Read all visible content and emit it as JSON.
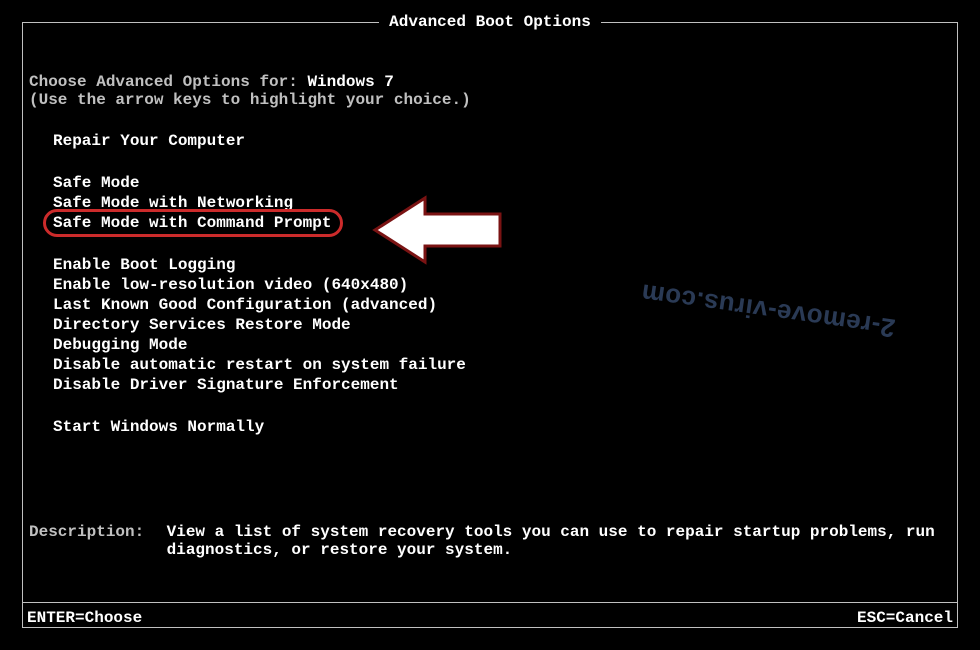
{
  "title": "Advanced Boot Options",
  "choose": {
    "prefix": "Choose Advanced Options for: ",
    "os": "Windows 7"
  },
  "hint": "(Use the arrow keys to highlight your choice.)",
  "menu": {
    "repair": "Repair Your Computer",
    "safe_mode": "Safe Mode",
    "safe_mode_net": "Safe Mode with Networking",
    "safe_mode_cmd": "Safe Mode with Command Prompt",
    "boot_logging": "Enable Boot Logging",
    "lowres": "Enable low-resolution video (640x480)",
    "last_known": "Last Known Good Configuration (advanced)",
    "dsrm": "Directory Services Restore Mode",
    "debug": "Debugging Mode",
    "no_auto_restart": "Disable automatic restart on system failure",
    "no_drv_sig": "Disable Driver Signature Enforcement",
    "start_normal": "Start Windows Normally"
  },
  "description": {
    "label": "Description:",
    "text": "View a list of system recovery tools you can use to repair startup problems, run diagnostics, or restore your system."
  },
  "footer": {
    "enter": "ENTER=Choose",
    "esc": "ESC=Cancel"
  },
  "watermark": "2-remove-virus.com",
  "annotation": {
    "arrow_points_to": "safe_mode_cmd"
  }
}
